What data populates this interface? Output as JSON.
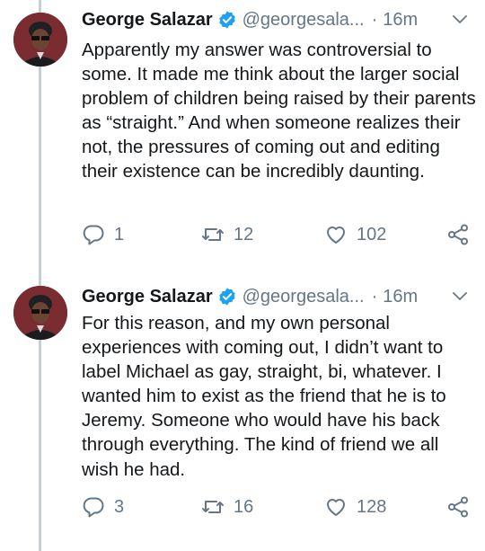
{
  "tweets": [
    {
      "name": "George Salazar",
      "handle": "@georgesala...",
      "separator": "·",
      "time": "16m",
      "text": "Apparently my answer was controversial to some. It made me think about the larger social problem of children being raised by their parents as “straight.” And when someone realizes their not, the pressures of coming out and editing their existence can be incredibly daunting.",
      "replies": "1",
      "retweets": "12",
      "likes": "102"
    },
    {
      "name": "George Salazar",
      "handle": "@georgesala...",
      "separator": "·",
      "time": "16m",
      "text": "For this reason, and my own personal experiences with coming out, I didn’t want to label Michael as gay, straight, bi, whatever. I wanted him to exist as the friend that he is to Jeremy. Someone who would have his back through everything. The kind of friend we all wish he had.",
      "replies": "3",
      "retweets": "16",
      "likes": "128"
    }
  ],
  "colors": {
    "text": "#14171a",
    "secondary": "#657786",
    "verified": "#1da1f2",
    "thread_line": "#c4cfd6"
  },
  "icons": [
    "verified-badge-icon",
    "chevron-down-icon",
    "reply-icon",
    "retweet-icon",
    "like-icon",
    "share-icon"
  ]
}
